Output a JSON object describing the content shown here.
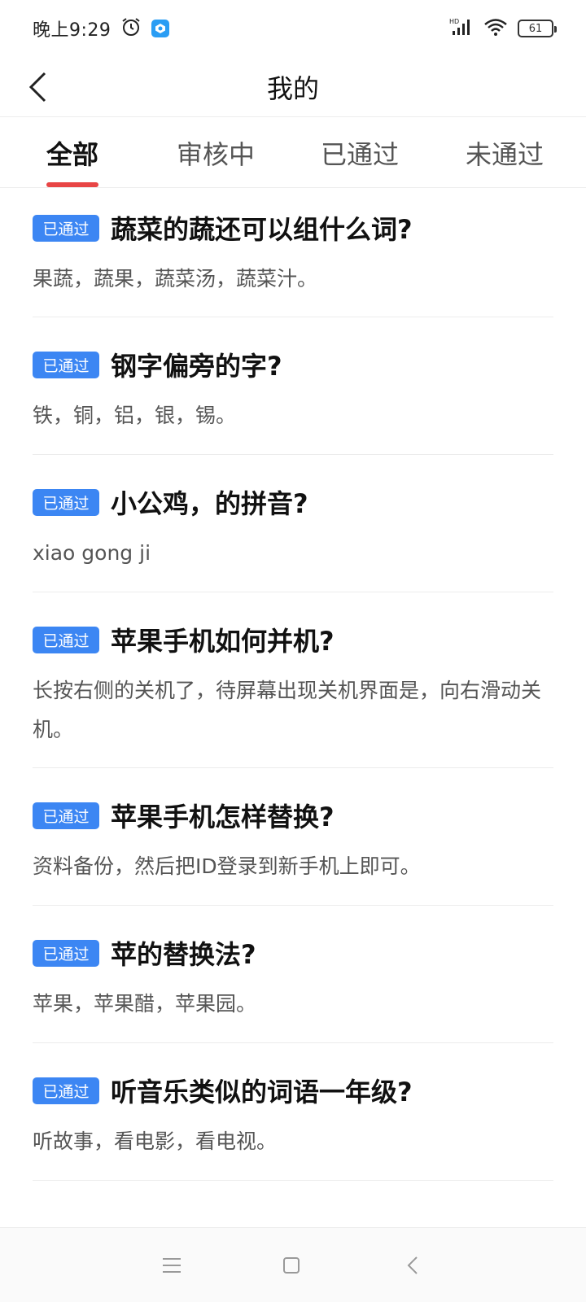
{
  "status_bar": {
    "time": "晚上9:29",
    "battery": "61",
    "icons": [
      "alarm-icon",
      "app-icon",
      "signal-icon",
      "wifi-icon",
      "battery-icon"
    ]
  },
  "header": {
    "title": "我的",
    "back_icon": "chevron-left-icon"
  },
  "tabs": [
    {
      "label": "全部",
      "active": true
    },
    {
      "label": "审核中",
      "active": false
    },
    {
      "label": "已通过",
      "active": false
    },
    {
      "label": "未通过",
      "active": false
    }
  ],
  "items": [
    {
      "badge": "已通过",
      "title": "蔬菜的蔬还可以组什么词?",
      "answer": "果蔬，蔬果，蔬菜汤，蔬菜汁。"
    },
    {
      "badge": "已通过",
      "title": "钢字偏旁的字?",
      "answer": "铁，铜，铝，银，锡。"
    },
    {
      "badge": "已通过",
      "title": "小公鸡，的拼音?",
      "answer": "xiao gong ji"
    },
    {
      "badge": "已通过",
      "title": "苹果手机如何并机?",
      "answer": "长按右侧的关机了，待屏幕出现关机界面是，向右滑动关机。"
    },
    {
      "badge": "已通过",
      "title": "苹果手机怎样替换?",
      "answer": "资料备份，然后把ID登录到新手机上即可。"
    },
    {
      "badge": "已通过",
      "title": "苹的替换法?",
      "answer": "苹果，苹果醋，苹果园。"
    },
    {
      "badge": "已通过",
      "title": "听音乐类似的词语一年级?",
      "answer": "听故事，看电影，看电视。"
    }
  ],
  "colors": {
    "accent": "#e84545",
    "badge": "#3c86f3"
  }
}
